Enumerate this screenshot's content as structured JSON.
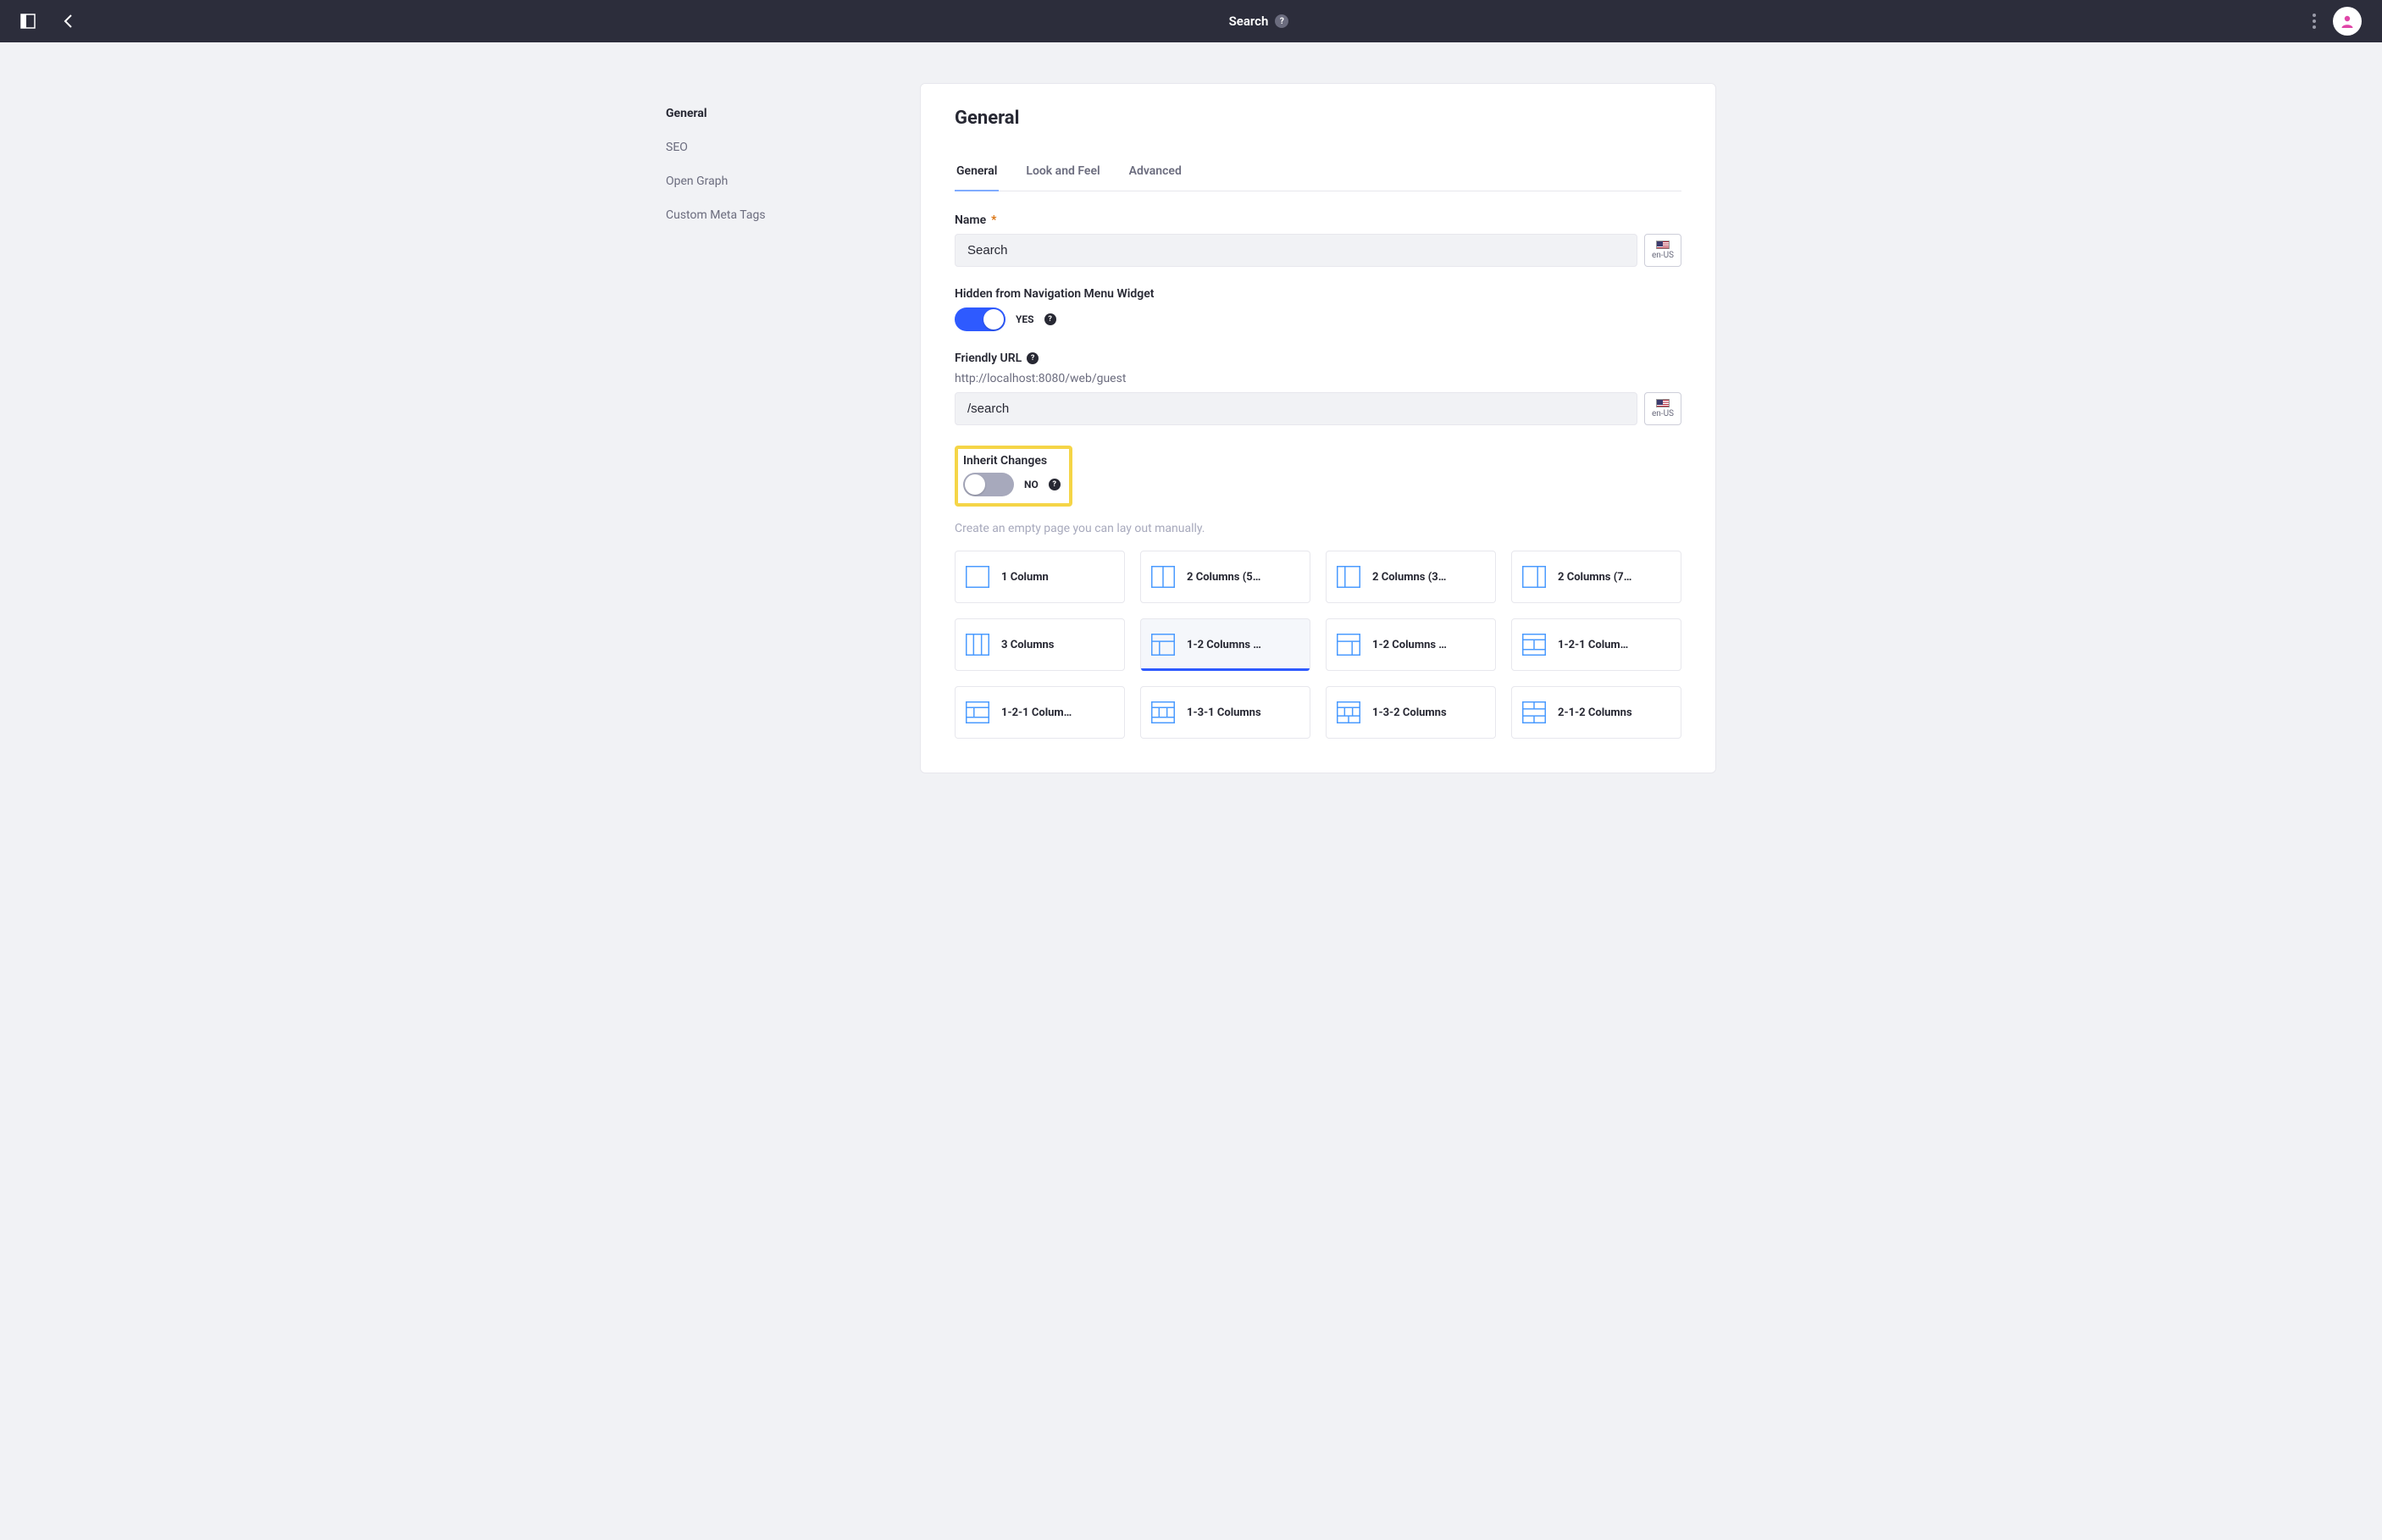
{
  "header": {
    "title": "Search"
  },
  "sidenav": {
    "items": [
      {
        "label": "General",
        "active": true
      },
      {
        "label": "SEO",
        "active": false
      },
      {
        "label": "Open Graph",
        "active": false
      },
      {
        "label": "Custom Meta Tags",
        "active": false
      }
    ]
  },
  "panel": {
    "heading": "General",
    "tabs": [
      {
        "label": "General",
        "active": true
      },
      {
        "label": "Look and Feel",
        "active": false
      },
      {
        "label": "Advanced",
        "active": false
      }
    ],
    "name_field": {
      "label": "Name",
      "value": "Search",
      "locale": "en-US"
    },
    "hidden_field": {
      "label": "Hidden from Navigation Menu Widget",
      "state_label": "YES",
      "on": true
    },
    "url_field": {
      "label": "Friendly URL",
      "base": "http://localhost:8080/web/guest",
      "value": "/search",
      "locale": "en-US"
    },
    "inherit_field": {
      "label": "Inherit Changes",
      "state_label": "NO",
      "on": false
    },
    "layout_hint": "Create an empty page you can lay out manually.",
    "layouts": [
      {
        "label": "1 Column",
        "icon": "l1",
        "selected": false
      },
      {
        "label": "2 Columns (5…",
        "icon": "l2-50",
        "selected": false
      },
      {
        "label": "2 Columns (3…",
        "icon": "l2-30",
        "selected": false
      },
      {
        "label": "2 Columns (7…",
        "icon": "l2-70",
        "selected": false
      },
      {
        "label": "3 Columns",
        "icon": "l3",
        "selected": false
      },
      {
        "label": "1-2 Columns …",
        "icon": "l1-2a",
        "selected": true
      },
      {
        "label": "1-2 Columns …",
        "icon": "l1-2b",
        "selected": false
      },
      {
        "label": "1-2-1 Colum…",
        "icon": "l1-2-1a",
        "selected": false
      },
      {
        "label": "1-2-1 Colum…",
        "icon": "l1-2-1b",
        "selected": false
      },
      {
        "label": "1-3-1 Columns",
        "icon": "l1-3-1",
        "selected": false
      },
      {
        "label": "1-3-2 Columns",
        "icon": "l1-3-2",
        "selected": false
      },
      {
        "label": "2-1-2 Columns",
        "icon": "l2-1-2",
        "selected": false
      }
    ]
  }
}
